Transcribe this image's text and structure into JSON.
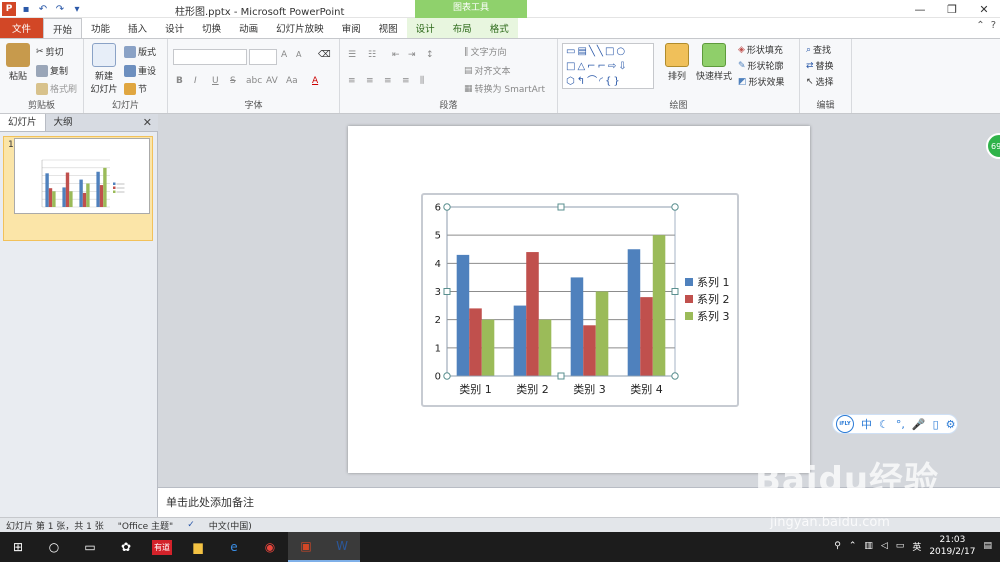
{
  "window": {
    "title": "柱形图.pptx - Microsoft PowerPoint",
    "context_group": "图表工具",
    "app_badge": "P"
  },
  "tabs": [
    "文件",
    "开始",
    "功能",
    "插入",
    "设计",
    "切换",
    "动画",
    "幻灯片放映",
    "审阅",
    "视图",
    "设计",
    "布局",
    "格式"
  ],
  "ribbon": {
    "clipboard": {
      "label": "剪贴板",
      "paste": "粘贴",
      "cut": "剪切",
      "copy": "复制",
      "format_painter": "格式刷"
    },
    "slides": {
      "label": "幻灯片",
      "new_slide_1": "新建",
      "new_slide_2": "幻灯片",
      "layout": "版式",
      "reset": "重设",
      "section": "节"
    },
    "font": {
      "label": "字体",
      "bold": "B",
      "italic": "I",
      "underline": "U",
      "strike": "S",
      "shadow": "abc",
      "spacing": "AV",
      "case": "Aa",
      "color": "A",
      "grow": "A",
      "shrink": "A"
    },
    "paragraph": {
      "label": "段落",
      "text_direction": "文字方向",
      "align_text": "对齐文本",
      "smartart": "转换为 SmartArt"
    },
    "drawing": {
      "label": "绘图",
      "arrange": "排列",
      "quick_styles": "快速样式",
      "shape_fill": "形状填充",
      "shape_outline": "形状轮廓",
      "shape_effects": "形状效果"
    },
    "editing": {
      "label": "编辑",
      "find": "查找",
      "replace": "替换",
      "select": "选择"
    }
  },
  "left_pane": {
    "tab_slides": "幻灯片",
    "tab_outline": "大纲",
    "slide_number": "1"
  },
  "chart_data": {
    "type": "bar",
    "categories": [
      "类别 1",
      "类别 2",
      "类别 3",
      "类别 4"
    ],
    "series": [
      {
        "name": "系列 1",
        "values": [
          4.3,
          2.5,
          3.5,
          4.5
        ],
        "color": "#4f81bd"
      },
      {
        "name": "系列 2",
        "values": [
          2.4,
          4.4,
          1.8,
          2.8
        ],
        "color": "#c0504d"
      },
      {
        "name": "系列 3",
        "values": [
          2,
          2,
          3,
          5
        ],
        "color": "#9bbb59"
      }
    ],
    "yticks": [
      "0",
      "1",
      "2",
      "3",
      "4",
      "5",
      "6"
    ],
    "ylim": [
      0,
      6
    ],
    "grid": true,
    "legend": "right"
  },
  "notes": {
    "placeholder": "单击此处添加备注"
  },
  "status": {
    "slide_info": "幻灯片 第 1 张，共 1 张",
    "theme": "\"Office 主题\"",
    "language": "中文(中国)"
  },
  "ifly": {
    "logo": "iFLY",
    "lang": "中"
  },
  "badge": {
    "text": "69"
  },
  "taskbar": {
    "time": "21:03",
    "date": "2019/2/17",
    "app_label": "有道"
  },
  "watermark": {
    "text": "Baidu经验",
    "url": "jingyan.baidu.com"
  }
}
